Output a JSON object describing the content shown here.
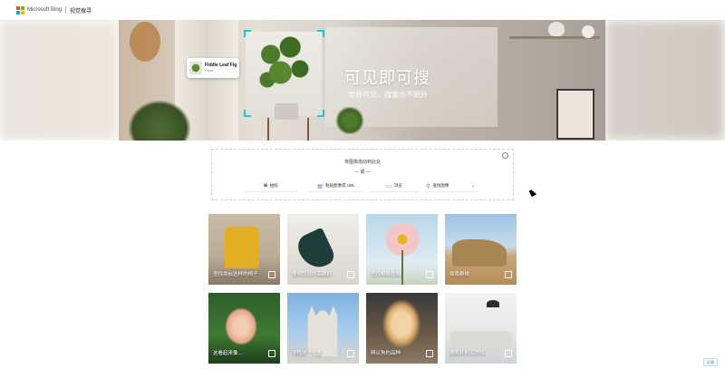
{
  "header": {
    "brand": "Microsoft Bing",
    "section": "视觉搜寻",
    "logo_colors": [
      "#f25022",
      "#7fba00",
      "#00a4ef",
      "#ffb900"
    ]
  },
  "hero": {
    "tag_title": "Fiddle Leaf Fig",
    "tag_subtitle": "Plant",
    "title": "可见即可搜",
    "subtitle": "世界可见，搜索也不例外"
  },
  "upload": {
    "drop_text": "将图像拖动到此处",
    "or_text": "— 或 —",
    "options": [
      {
        "label": "拍照",
        "icon": "camera-icon"
      },
      {
        "label": "粘贴图像或 URL",
        "icon": "paste-icon"
      },
      {
        "label": "浏览",
        "icon": "browse-icon"
      },
      {
        "label": "查找图像",
        "icon": "search-icon"
      }
    ]
  },
  "tiles": [
    {
      "label": "查找类似这样的椅子"
    },
    {
      "label": "搜索同款的高跟鞋"
    },
    {
      "label": "查找相似图像"
    },
    {
      "label": "探索群体"
    },
    {
      "label": "这看起来像..."
    },
    {
      "label": "寻找这个位置"
    },
    {
      "label": "辨认狗的品种"
    },
    {
      "label": "搜索并购买房间"
    }
  ],
  "feedback": {
    "label": "反馈"
  },
  "accent_color": "#22c3e6"
}
